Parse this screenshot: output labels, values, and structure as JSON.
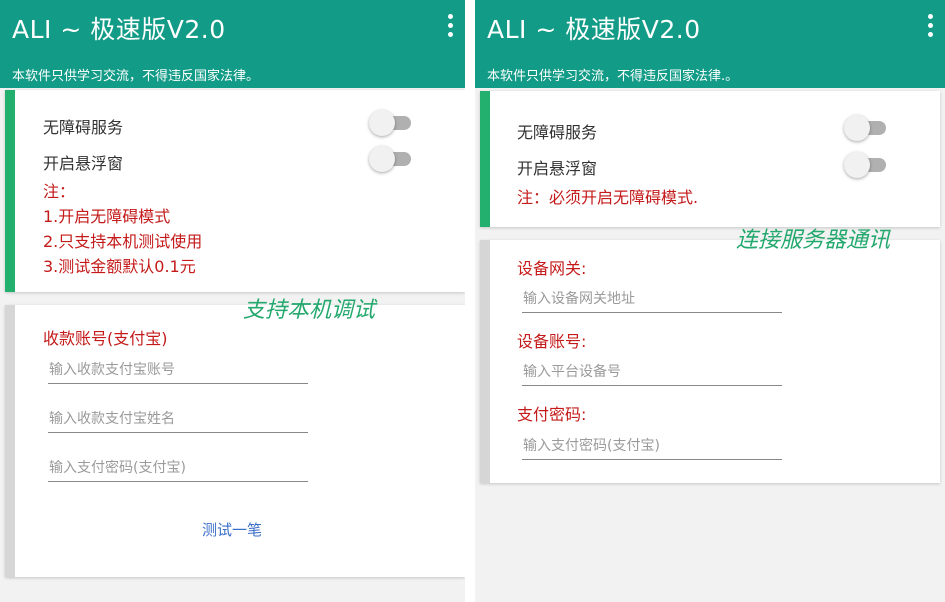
{
  "left": {
    "app_title": "ALI ~ 极速版V2.0",
    "subtitle": "本软件只供学习交流，不得违反国家法律。",
    "service_card": {
      "toggle_accessibility_label": "无障碍服务",
      "toggle_float_label": "开启悬浮窗",
      "note_lines": [
        "注：",
        "1.开启无障碍模式",
        "2.只支持本机测试使用",
        "3.测试金额默认0.1元"
      ]
    },
    "caption": "支持本机调试",
    "account_card": {
      "section_label": "收款账号(支付宝)",
      "account_placeholder": "输入收款支付宝账号",
      "name_placeholder": "输入收款支付宝姓名",
      "password_placeholder": "输入支付密码(支付宝)",
      "test_button_label": "测试一笔"
    }
  },
  "right": {
    "app_title": "ALI ~ 极速版V2.0",
    "subtitle": "本软件只供学习交流，不得违反国家法律.。",
    "service_card": {
      "toggle_accessibility_label": "无障碍服务",
      "toggle_float_label": "开启悬浮窗",
      "note": "注：必须开启无障碍模式."
    },
    "caption": "连接服务器通讯",
    "device_card": {
      "gateway_label": "设备网关:",
      "gateway_placeholder": "输入设备网关地址",
      "account_label": "设备账号:",
      "account_placeholder": "输入平台设备号",
      "password_label": "支付密码:",
      "password_placeholder": "输入支付密码(支付宝)"
    }
  },
  "colors": {
    "app_bar": "#129b86",
    "accent_bar": "#23b06f",
    "note_red": "#c41a1a",
    "caption_green": "#23a86d",
    "link_blue": "#3b6fc9"
  },
  "icons": {
    "overflow_menu": "more-vert-icon"
  }
}
